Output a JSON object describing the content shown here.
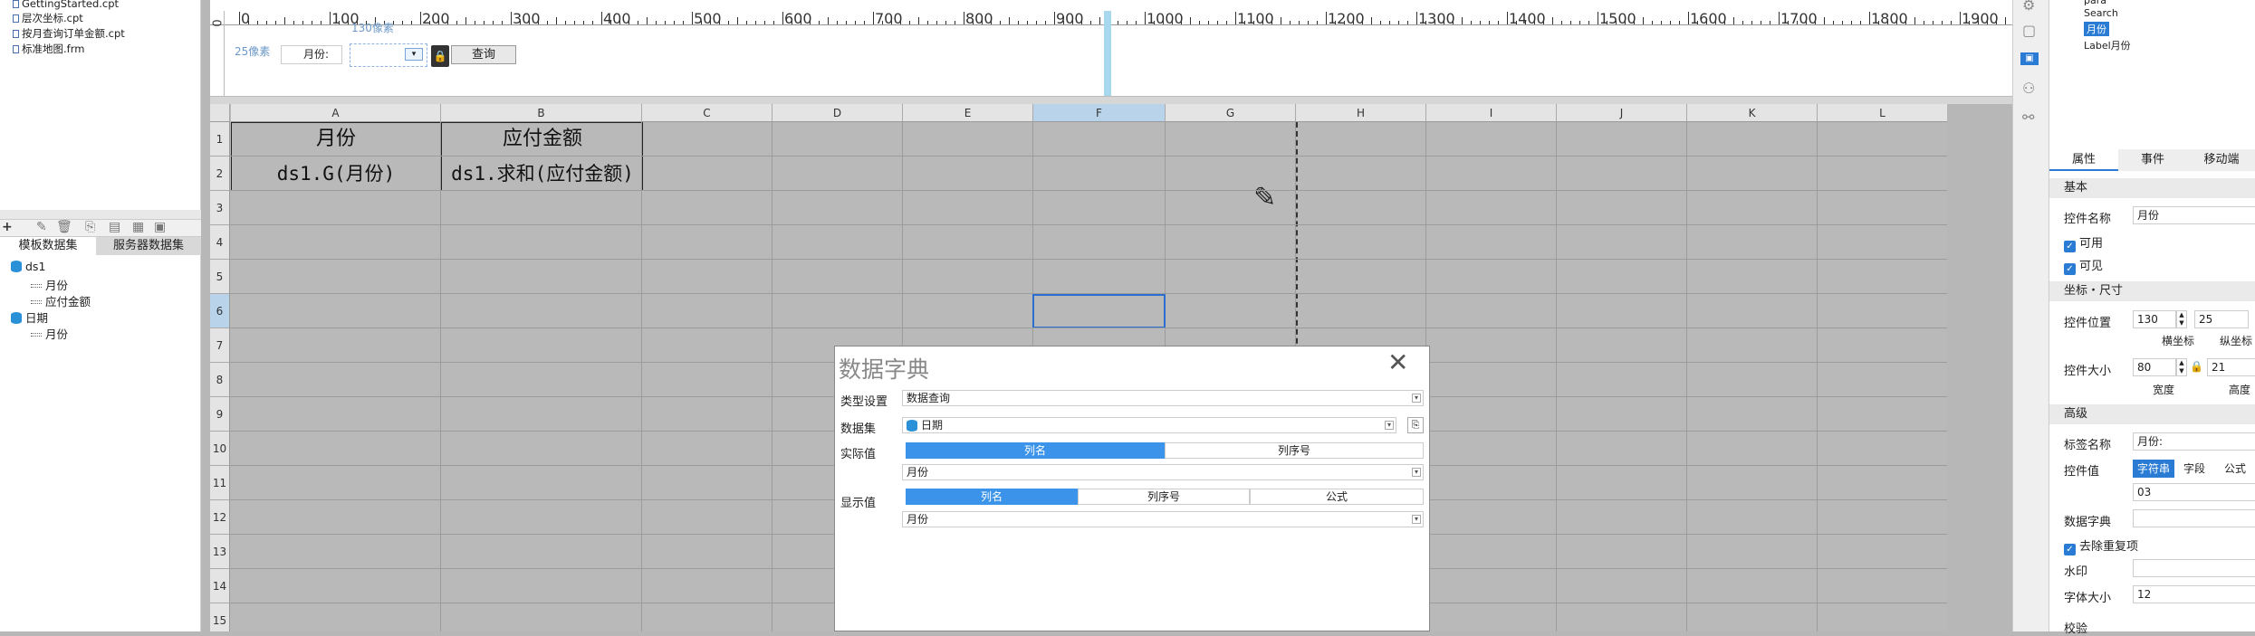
{
  "left_panel": {
    "files": [
      "GettingStarted.cpt",
      "层次坐标.cpt",
      "按月查询订单金额.cpt",
      "标准地图.frm"
    ],
    "toolbar_plus": "+",
    "tabs": [
      "模板数据集",
      "服务器数据集"
    ],
    "datasets": [
      {
        "name": "ds1",
        "columns": [
          "月份",
          "应付金额"
        ]
      },
      {
        "name": "日期",
        "columns": [
          "月份"
        ]
      }
    ]
  },
  "param_panel": {
    "ruler_labels": [
      "0",
      "100",
      "200",
      "300",
      "400",
      "500",
      "600",
      "700",
      "800",
      "900",
      "1000",
      "1100",
      "1200",
      "1300",
      "1400",
      "1500",
      "1600",
      "1700",
      "1800",
      "1900"
    ],
    "vruler_label": "0",
    "width_hint": "130像素",
    "left_hint": "25像素",
    "month_label": "月份:",
    "query_button": "查询"
  },
  "grid": {
    "columns": [
      "A",
      "B",
      "C",
      "D",
      "E",
      "F",
      "G",
      "H",
      "I",
      "J",
      "K",
      "L"
    ],
    "rows": [
      "1",
      "2",
      "3",
      "4",
      "5",
      "6",
      "7",
      "8",
      "9",
      "10",
      "11",
      "12",
      "13",
      "14",
      "15"
    ],
    "a1": "月份",
    "b1": "应付金额",
    "a2": "ds1.G(月份)",
    "b2": "ds1.求和(应付金额)"
  },
  "dialog": {
    "title": "数据字典",
    "type_label": "类型设置",
    "type_value": "数据查询",
    "dataset_label": "数据集",
    "dataset_value": "日期",
    "actual_label": "实际值",
    "actual_tabs": [
      "列名",
      "列序号"
    ],
    "actual_value": "月份",
    "display_label": "显示值",
    "display_tabs": [
      "列名",
      "列序号",
      "公式"
    ],
    "display_value": "月份"
  },
  "right_panel": {
    "tree_items": [
      "para",
      "Search",
      "月份",
      "Label月份"
    ],
    "tabs": [
      "属性",
      "事件",
      "移动端"
    ],
    "basic_title": "基本",
    "name_label": "控件名称",
    "name_value": "月份",
    "enabled_label": "可用",
    "visible_label": "可见",
    "coord_title": "坐标・尺寸",
    "pos_label": "控件位置",
    "pos_x": "130",
    "pos_y": "25",
    "x_caption": "横坐标",
    "y_caption": "纵坐标",
    "size_label": "控件大小",
    "size_w": "80",
    "size_h": "21",
    "w_caption": "宽度",
    "h_caption": "高度",
    "adv_title": "高级",
    "tag_label": "标签名称",
    "tag_value": "月份:",
    "value_label": "控件值",
    "value_tabs": [
      "字符串",
      "字段",
      "公式"
    ],
    "value_value": "03",
    "dict_label": "数据字典",
    "dedupe_label": "去除重复项",
    "watermark_label": "水印",
    "font_label": "字体大小",
    "font_value": "12",
    "check_label": "校验"
  }
}
